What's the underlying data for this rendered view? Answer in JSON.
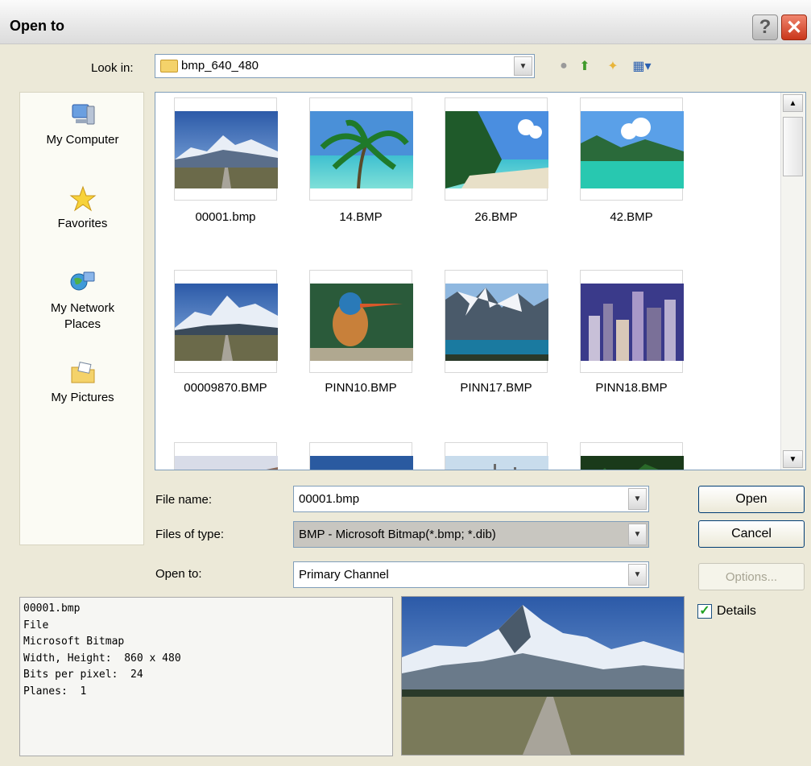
{
  "window": {
    "title": "Open to"
  },
  "lookin": {
    "label": "Look in:",
    "value": "bmp_640_480"
  },
  "places": [
    {
      "label": "My Computer",
      "icon": "computer-icon"
    },
    {
      "label": "Favorites",
      "icon": "star-icon"
    },
    {
      "label": "My Network\nPlaces",
      "icon": "network-icon"
    },
    {
      "label": "My Pictures",
      "icon": "pictures-folder-icon"
    }
  ],
  "files": [
    {
      "name": "00001.bmp",
      "scene": "mountain-road"
    },
    {
      "name": "14.BMP",
      "scene": "palm-beach"
    },
    {
      "name": "26.BMP",
      "scene": "tropical-shore"
    },
    {
      "name": "42.BMP",
      "scene": "lagoon"
    },
    {
      "name": "00009870.BMP",
      "scene": "mountain-road"
    },
    {
      "name": "PINN10.BMP",
      "scene": "kingfisher"
    },
    {
      "name": "PINN17.BMP",
      "scene": "alpine-lake"
    },
    {
      "name": "PINN18.BMP",
      "scene": "city-skyline"
    }
  ],
  "form": {
    "filename_label": "File name:",
    "filename_value": "00001.bmp",
    "filetype_label": "Files of type:",
    "filetype_value": "BMP - Microsoft Bitmap(*.bmp; *.dib)",
    "opento_label": "Open to:",
    "opento_value": "Primary Channel"
  },
  "buttons": {
    "open": "Open",
    "cancel": "Cancel",
    "options": "Options..."
  },
  "details_checkbox": {
    "label": "Details",
    "checked": true
  },
  "details": {
    "name": "00001.bmp",
    "kind": "File",
    "format": "Microsoft Bitmap",
    "dimensions": "Width, Height:  860 x 480",
    "bits": "Bits per pixel:  24",
    "planes": "Planes:  1"
  },
  "colors": {
    "accent_border": "#003c74",
    "close_red": "#c9361a",
    "check_green": "#21a121"
  }
}
